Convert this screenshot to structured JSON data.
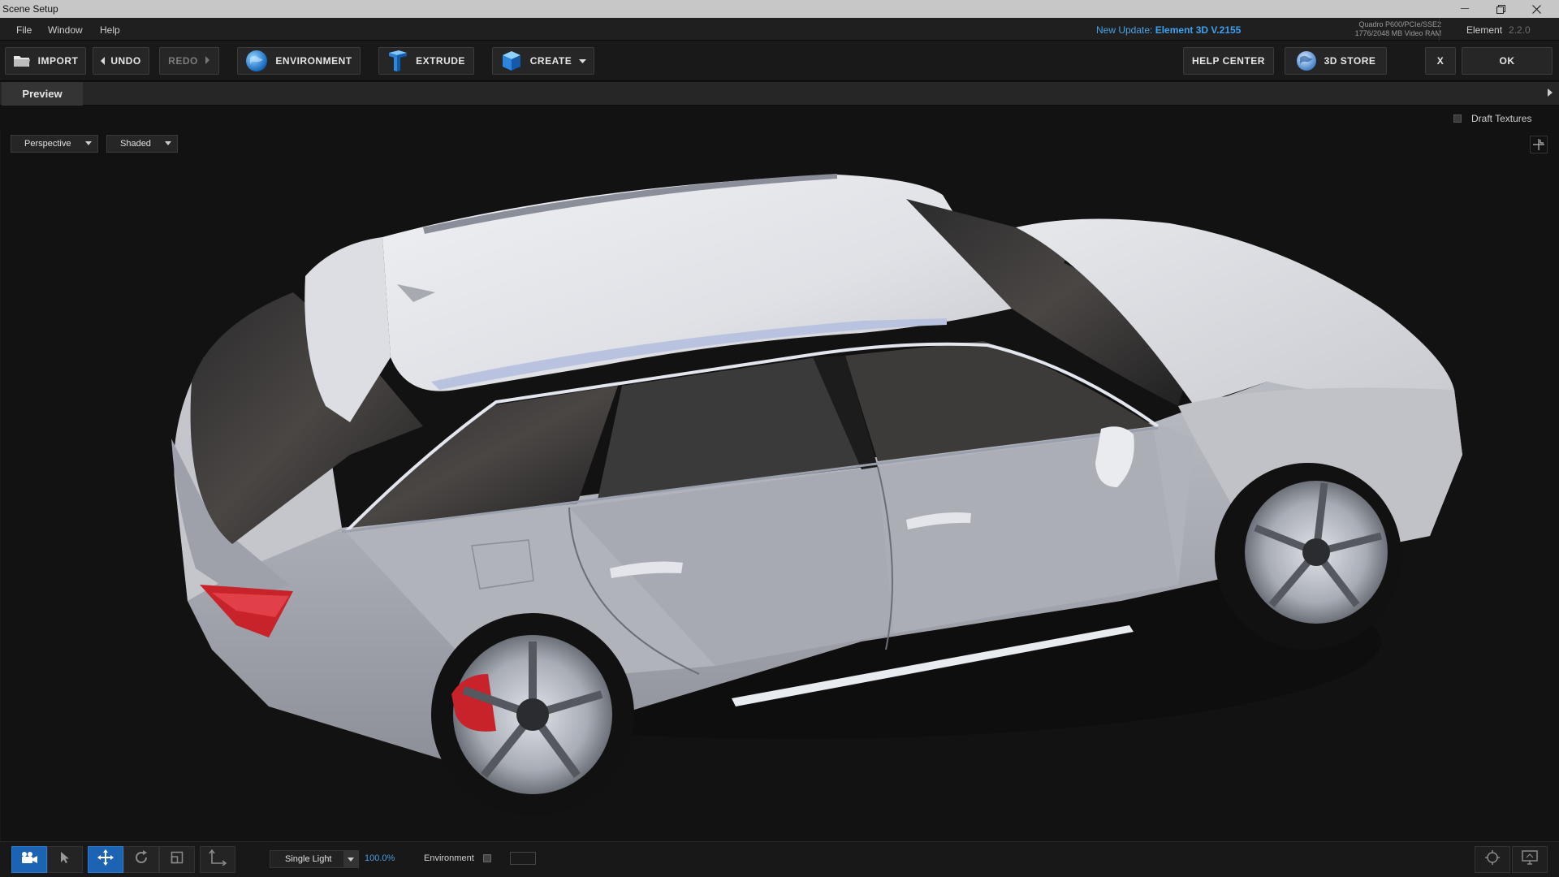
{
  "window": {
    "title": "Scene Setup"
  },
  "menu": {
    "items": [
      "File",
      "Window",
      "Help"
    ]
  },
  "update": {
    "prefix": "New Update:",
    "version": "Element 3D V.2155"
  },
  "gpu": {
    "line1": "Quadro P600/PCIe/SSE2",
    "line2": "1776/2048 MB Video RAM"
  },
  "product": {
    "name": "Element",
    "version": "2.2.0"
  },
  "toolbar": {
    "import": "IMPORT",
    "undo": "UNDO",
    "redo": "REDO",
    "environment": "ENVIRONMENT",
    "extrude": "EXTRUDE",
    "create": "CREATE",
    "help_center": "HELP CENTER",
    "store": "3D STORE",
    "close": "X",
    "ok": "OK"
  },
  "tabs": {
    "preview": "Preview"
  },
  "options": {
    "draft_textures": "Draft Textures",
    "draft_textures_checked": false
  },
  "viewport": {
    "camera": "Perspective",
    "shading": "Shaded"
  },
  "bottom": {
    "light_mode": "Single Light",
    "zoom": "100.0%",
    "environment_label": "Environment",
    "environment_checked": false,
    "active_tool": "move"
  },
  "colors": {
    "accent": "#1d63b3",
    "update_blue": "#3fa0f0",
    "car_body": "#c9cbd0",
    "brake": "#c8222a"
  }
}
